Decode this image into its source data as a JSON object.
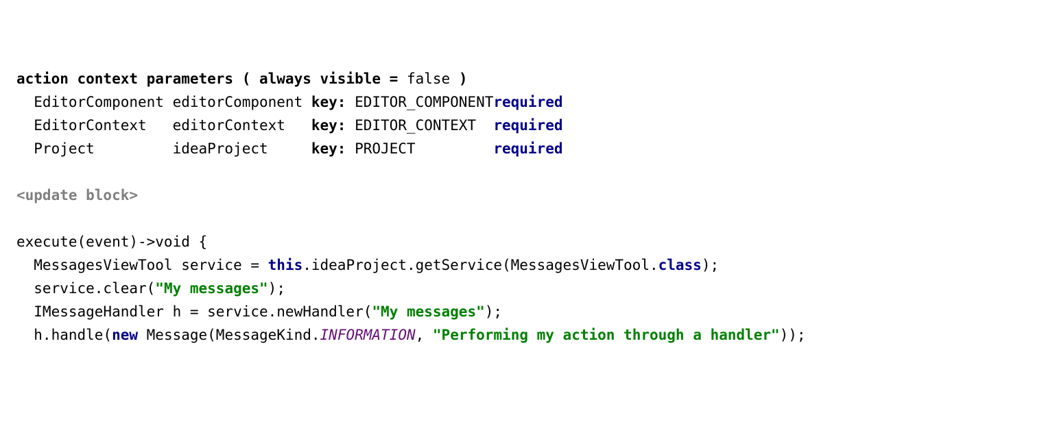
{
  "header": {
    "prefix": "action context parameters ( always visible",
    "eq": " =",
    "value": " false",
    "suffix": " )"
  },
  "params": [
    {
      "type": "EditorComponent",
      "name": "editorComponent",
      "keyLabel": "key:",
      "key": " EDITOR_COMPONENT",
      "required": "required"
    },
    {
      "type": "EditorContext",
      "name": "editorContext",
      "keyLabel": "key:",
      "key": " EDITOR_CONTEXT",
      "required": "required"
    },
    {
      "type": "Project",
      "name": "ideaProject",
      "keyLabel": "key:",
      "key": " PROJECT",
      "required": "required"
    }
  ],
  "updateBlock": "<update block>",
  "execute": {
    "sig_start": "execute(event)->void {",
    "line1": {
      "a": "MessagesViewTool service = ",
      "this": "this",
      "b": ".ideaProject.getService(MessagesViewTool.",
      "class": "class",
      "c": ");"
    },
    "line2": {
      "a": "service.clear(",
      "str": "\"My messages\"",
      "b": ");"
    },
    "line3": {
      "a": "IMessageHandler h = service.newHandler(",
      "str": "\"My messages\"",
      "b": ");"
    },
    "line4": {
      "a": "h.handle(",
      "new": "new",
      "b": " Message(MessageKind.",
      "const": "INFORMATION",
      "c": ", ",
      "str": "\"Performing my action through a handler\"",
      "d": "));"
    }
  }
}
